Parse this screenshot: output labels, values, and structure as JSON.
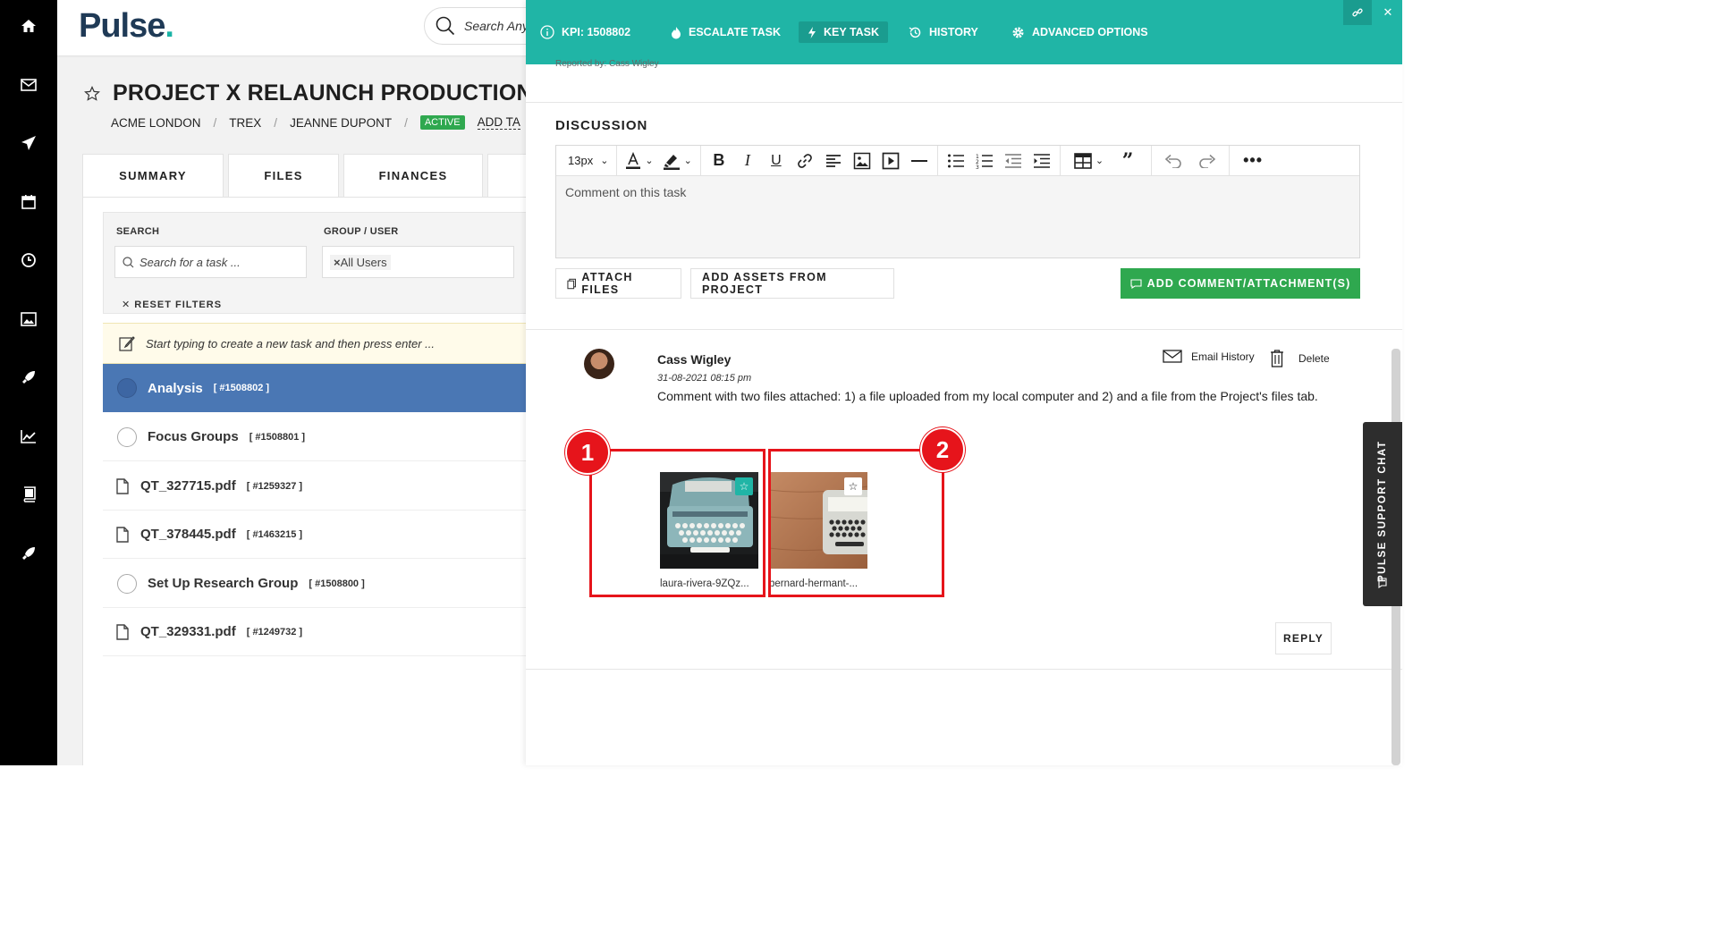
{
  "rail": {
    "icons": [
      "home-icon",
      "mail-icon",
      "send-icon",
      "calendar-icon",
      "clock-icon",
      "image-icon",
      "rocket-icon",
      "chart-icon",
      "book-icon",
      "rocket-icon"
    ]
  },
  "app": {
    "logo": "Pulse",
    "logo_dot": ".",
    "search_placeholder": "Search Anyth",
    "project_title": "PROJECT X RELAUNCH PRODUCTION",
    "breadcrumb": {
      "client": "ACME LONDON",
      "brand": "TREX",
      "manager": "JEANNE DUPONT",
      "status": "ACTIVE",
      "add_tag": "ADD TA",
      "sep": "/"
    },
    "tabs": [
      "SUMMARY",
      "FILES",
      "FINANCES"
    ],
    "filters": {
      "search_label": "SEARCH",
      "search_placeholder": "Search for a task ...",
      "group_label": "GROUP / USER",
      "group_chip_x": "×",
      "group_value": "All Users",
      "reset_label": "RESET FILTERS"
    },
    "new_task_placeholder": "Start typing to create a new task and then press enter ...",
    "tasks": [
      {
        "name": "Analysis",
        "id": "[ #1508802 ]",
        "type": "task"
      },
      {
        "name": "Focus Groups",
        "id": "[ #1508801 ]",
        "type": "task"
      },
      {
        "name": "QT_327715.pdf",
        "id": "[ #1259327 ]",
        "type": "file"
      },
      {
        "name": "QT_378445.pdf",
        "id": "[ #1463215 ]",
        "type": "file"
      },
      {
        "name": "Set Up Research Group",
        "id": "[ #1508800 ]",
        "type": "task"
      },
      {
        "name": "QT_329331.pdf",
        "id": "[ #1249732 ]",
        "type": "file"
      }
    ]
  },
  "panel": {
    "header": {
      "kpi": "KPI: 1508802",
      "escalate": "ESCALATE TASK",
      "key_task": "KEY TASK",
      "history": "HISTORY",
      "advanced": "ADVANCED OPTIONS"
    },
    "reported_by": "Reported by: Cass Wigley",
    "discussion_title": "DISCUSSION",
    "editor": {
      "font_size": "13px",
      "placeholder": "Comment on this task"
    },
    "attach_files": "ATTACH FILES",
    "add_assets": "ADD ASSETS FROM PROJECT",
    "add_comment": "ADD COMMENT/ATTACHMENT(S)",
    "comment": {
      "author": "Cass Wigley",
      "date": "31-08-2021 08:15 pm",
      "text": "Comment with two files attached: 1) a file uploaded from my local computer and 2)  and a file from the Project's files tab.",
      "email_history": "Email History",
      "delete": "Delete",
      "attachments": [
        {
          "name": "laura-rivera-9ZQz...",
          "starred": true,
          "marker": "1"
        },
        {
          "name": "bernard-hermant-...",
          "starred": false,
          "marker": "2"
        }
      ],
      "reply": "REPLY"
    }
  },
  "support_chat": "PULSE SUPPORT CHAT",
  "colors": {
    "teal": "#20b5a6",
    "green": "#2fa84f",
    "selected_blue": "#4a77b4",
    "highlight_red": "#e6141b"
  }
}
